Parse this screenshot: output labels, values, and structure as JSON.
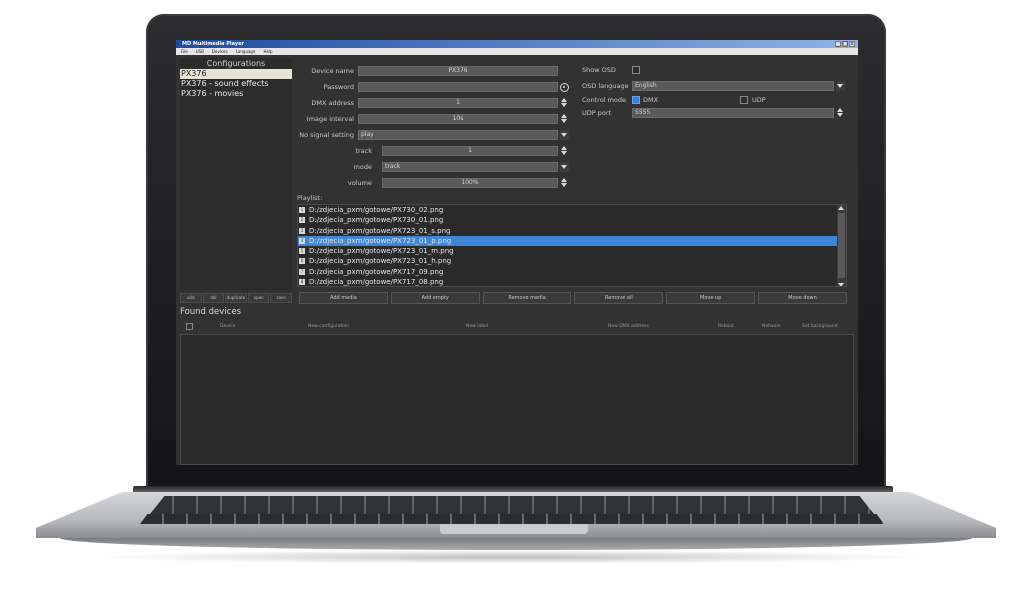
{
  "app": {
    "title": "MD Multimedia Player",
    "window_buttons": [
      "_",
      "□",
      "x"
    ],
    "menu": [
      "File",
      "USB",
      "Devices",
      "Language",
      "Help"
    ]
  },
  "configurations": {
    "header": "Configurations",
    "items": [
      "PX376",
      "PX376 - sound effects",
      "PX376 - movies"
    ],
    "selected_index": 0,
    "buttons": [
      "add",
      "del",
      "duplicate",
      "open",
      "save"
    ]
  },
  "settings": {
    "device_name": {
      "label": "Device name",
      "value": "PX376"
    },
    "password": {
      "label": "Password",
      "value": ""
    },
    "dmx_address": {
      "label": "DMX address",
      "value": "1"
    },
    "image_interval": {
      "label": "Image interval",
      "value": "10s"
    },
    "no_signal": {
      "label": "No signal setting",
      "value": "play"
    },
    "track": {
      "label": "track",
      "value": "1"
    },
    "mode": {
      "label": "mode",
      "value": "track"
    },
    "volume": {
      "label": "volume",
      "value": "100%"
    }
  },
  "osd": {
    "show_osd_label": "Show OSD",
    "show_osd_checked": false,
    "language_label": "OSD language",
    "language_value": "English",
    "control_mode_label": "Control mode",
    "dmx_label": "DMX",
    "dmx_checked": true,
    "udp_label": "UDP",
    "udp_checked": false,
    "udp_port_label": "UDP port",
    "udp_port_value": "5555"
  },
  "playlist": {
    "label": "Playlist:",
    "items": [
      {
        "num": "1",
        "path": "D:/zdjecia_pxm/gotowe/PX730_02.png"
      },
      {
        "num": "2",
        "path": "D:/zdjecia_pxm/gotowe/PX730_01.png"
      },
      {
        "num": "3",
        "path": "D:/zdjecia_pxm/gotowe/PX723_01_s.png"
      },
      {
        "num": "4",
        "path": "D:/zdjecia_pxm/gotowe/PX723_01_p.png"
      },
      {
        "num": "5",
        "path": "D:/zdjecia_pxm/gotowe/PX723_01_m.png"
      },
      {
        "num": "6",
        "path": "D:/zdjecia_pxm/gotowe/PX723_01_h.png"
      },
      {
        "num": "7",
        "path": "D:/zdjecia_pxm/gotowe/PX717_09.png"
      },
      {
        "num": "8",
        "path": "D:/zdjecia_pxm/gotowe/PX717_08.png"
      }
    ],
    "selected_index": 3,
    "buttons": [
      "Add media",
      "Add empty",
      "Remove media",
      "Remove all",
      "Move up",
      "Move down"
    ]
  },
  "found_devices": {
    "title": "Found devices",
    "columns": [
      "Device",
      "New configuration",
      "New label",
      "New DMX address",
      "Reboot",
      "Network",
      "Set background"
    ]
  },
  "colors": {
    "selection": "#3f86d8",
    "titlebar": "#1d4b9e",
    "background": "#323232"
  }
}
